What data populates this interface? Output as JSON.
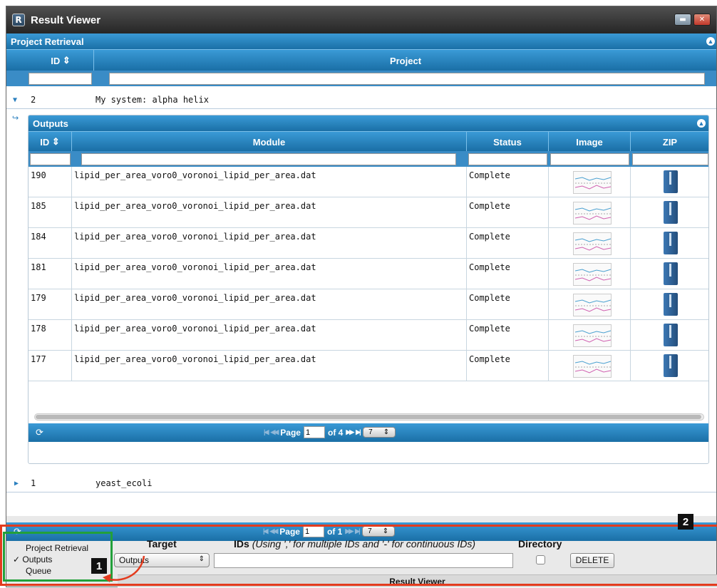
{
  "window": {
    "title": "Result Viewer",
    "icon_letter": "R",
    "minimize_glyph": "▬",
    "close_glyph": "✕"
  },
  "project_grid": {
    "caption": "Project Retrieval",
    "columns": [
      "ID",
      "Project"
    ],
    "sort_glyph": "⇕",
    "rows": [
      {
        "id": "2",
        "project": "My system: alpha helix",
        "expanded": true
      },
      {
        "id": "1",
        "project": "yeast_ecoli",
        "expanded": false
      }
    ],
    "pager": {
      "page_label": "Page",
      "page": "1",
      "of_label": "of 1",
      "per_page": "7"
    }
  },
  "outputs_grid": {
    "caption": "Outputs",
    "columns": [
      "ID",
      "Module",
      "Status",
      "Image",
      "ZIP"
    ],
    "rows": [
      {
        "id": "190",
        "module": "lipid_per_area_voro0_voronoi_lipid_per_area.dat",
        "status": "Complete"
      },
      {
        "id": "185",
        "module": "lipid_per_area_voro0_voronoi_lipid_per_area.dat",
        "status": "Complete"
      },
      {
        "id": "184",
        "module": "lipid_per_area_voro0_voronoi_lipid_per_area.dat",
        "status": "Complete"
      },
      {
        "id": "181",
        "module": "lipid_per_area_voro0_voronoi_lipid_per_area.dat",
        "status": "Complete"
      },
      {
        "id": "179",
        "module": "lipid_per_area_voro0_voronoi_lipid_per_area.dat",
        "status": "Complete"
      },
      {
        "id": "178",
        "module": "lipid_per_area_voro0_voronoi_lipid_per_area.dat",
        "status": "Complete"
      },
      {
        "id": "177",
        "module": "lipid_per_area_voro0_voronoi_lipid_per_area.dat",
        "status": "Complete"
      }
    ],
    "pager": {
      "page_label": "Page",
      "page": "1",
      "of_label": "of 4",
      "per_page": "7"
    }
  },
  "view_menu": {
    "items": [
      "Project Retrieval",
      "Outputs",
      "Queue"
    ],
    "checked": "Outputs",
    "check_glyph": "✓"
  },
  "delete_form": {
    "target_label": "Target",
    "target_value": "Outputs",
    "ids_label": "IDs",
    "ids_hint": "(Using ',' for multiple IDs and '-' for continuous IDs)",
    "directory_label": "Directory",
    "delete_button": "DELETE"
  },
  "status_bar": "Result Viewer",
  "annotations": {
    "tag1": "1",
    "tag2": "2",
    "box1_color": "#22a03a",
    "box2_color": "#e33b1e"
  },
  "colors": {
    "header_blue": "#2a86c7"
  }
}
